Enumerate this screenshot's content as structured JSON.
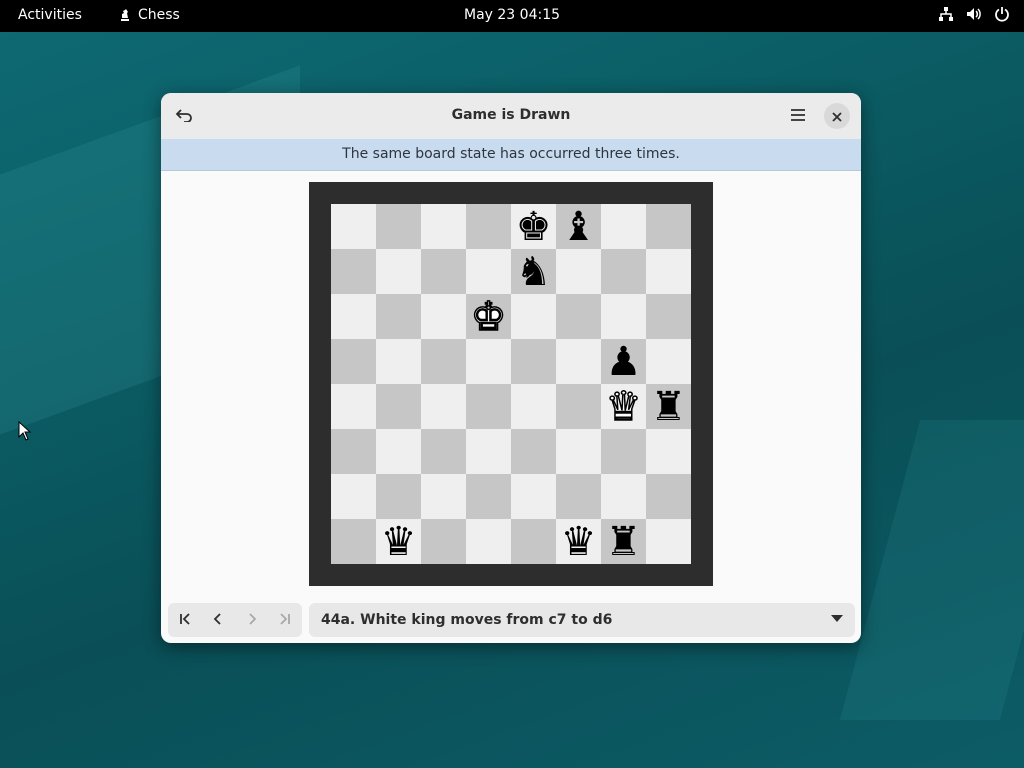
{
  "topbar": {
    "activities": "Activities",
    "app_name": "Chess",
    "clock": "May 23  04:15",
    "tray_icons": [
      "network-icon",
      "volume-icon",
      "power-icon"
    ]
  },
  "window": {
    "title": "Game is Drawn",
    "info_message": "The same board state has occurred three times.",
    "move_selector_value": "44a. White king moves from c7 to d6",
    "nav_buttons": [
      "first-move",
      "previous-move",
      "next-move",
      "last-move"
    ]
  },
  "board": {
    "rows": [
      [
        "",
        "",
        "",
        "",
        "bK",
        "bB",
        "",
        ""
      ],
      [
        "",
        "",
        "",
        "",
        "bN",
        "",
        "",
        ""
      ],
      [
        "",
        "",
        "",
        "wK",
        "",
        "",
        "",
        ""
      ],
      [
        "",
        "",
        "",
        "",
        "",
        "",
        "bP",
        ""
      ],
      [
        "",
        "",
        "",
        "",
        "",
        "",
        "wQ",
        "bR"
      ],
      [
        "",
        "",
        "",
        "",
        "",
        "",
        "",
        ""
      ],
      [
        "",
        "",
        "",
        "",
        "",
        "",
        "",
        ""
      ],
      [
        "",
        "bQ",
        "",
        "",
        "",
        "bQ",
        "bR",
        ""
      ]
    ]
  },
  "colors": {
    "light_square": "#efefef",
    "dark_square": "#c6c6c6",
    "board_border": "#2d2d2d",
    "info_bar": "#c9dcef"
  }
}
